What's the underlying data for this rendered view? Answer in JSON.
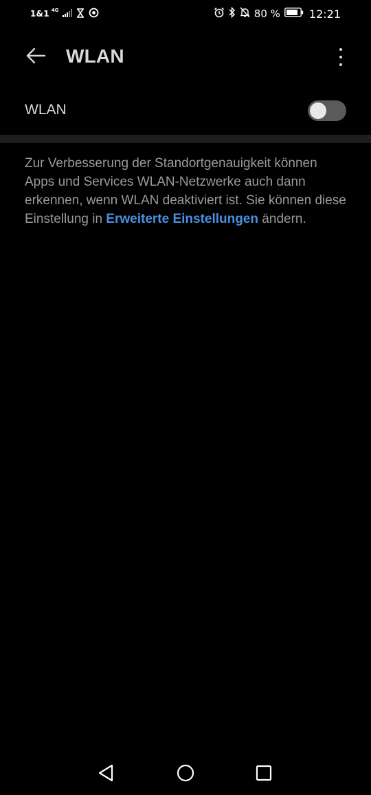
{
  "status_bar": {
    "carrier": "1&1",
    "network_type": "4G",
    "battery_percent": "80 %",
    "time": "12:21",
    "left_icons": [
      "signal-icon",
      "hourglass-icon",
      "sync-icon"
    ],
    "right_icons": [
      "alarm-icon",
      "bluetooth-icon",
      "mute-icon",
      "battery-icon"
    ]
  },
  "app_bar": {
    "title": "WLAN",
    "back_icon": "back-arrow-icon",
    "menu_icon": "more-vert-icon"
  },
  "toggle": {
    "label": "WLAN",
    "state": "off"
  },
  "info": {
    "text_before_link": "Zur Verbesserung der Standortgenauigkeit können Apps und Services WLAN-Netzwerke auch dann erkennen, wenn WLAN deaktiviert ist. Sie können diese Einstellung in ",
    "link_text": "Erweiterte Einstellungen",
    "text_after_link": " ändern."
  },
  "nav_bar": {
    "icons": [
      "nav-back-icon",
      "nav-home-icon",
      "nav-recents-icon"
    ]
  },
  "colors": {
    "background": "#000000",
    "text_primary": "#d9d9d9",
    "text_secondary": "#9a9a9a",
    "link": "#4a90e2",
    "switch_track_off": "#5a5a5a",
    "divider": "#1e1e1e"
  }
}
